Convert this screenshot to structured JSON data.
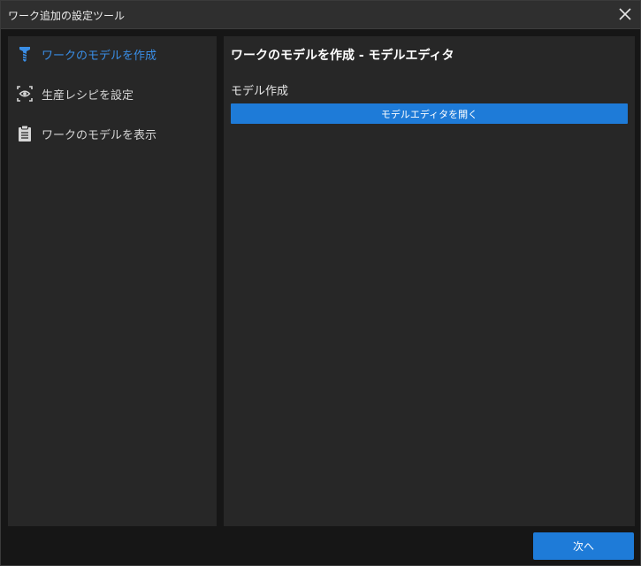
{
  "window": {
    "title": "ワーク追加の設定ツール",
    "close_icon": "close-icon"
  },
  "sidebar": {
    "items": [
      {
        "label": "ワークのモデルを作成",
        "icon": "screw-icon",
        "active": true
      },
      {
        "label": "生産レシピを設定",
        "icon": "eye-scan-icon",
        "active": false
      },
      {
        "label": "ワークのモデルを表示",
        "icon": "clipboard-icon",
        "active": false
      }
    ]
  },
  "main": {
    "title": "ワークのモデルを作成 - モデルエディタ",
    "section_label": "モデル作成",
    "open_editor_label": "モデルエディタを開く"
  },
  "footer": {
    "next_label": "次へ"
  },
  "colors": {
    "accent": "#1e7bd8",
    "active_text": "#3a8ee6",
    "panel_bg": "#272727",
    "window_bg": "#161616"
  }
}
